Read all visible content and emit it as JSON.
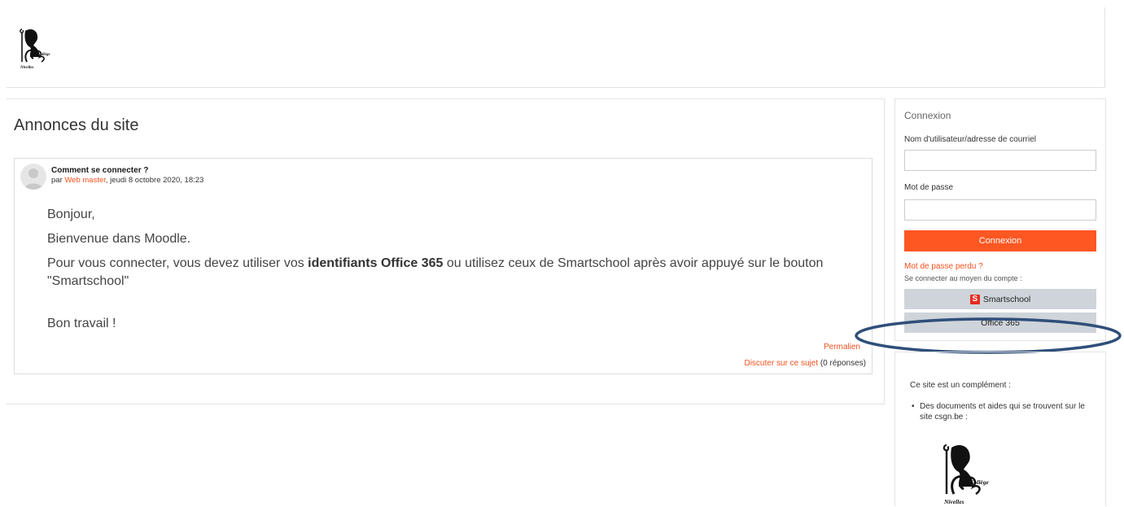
{
  "header": {
    "logo": {
      "icon": "college-logo-icon",
      "text_1": "Collège",
      "text_2": "Nivelles"
    }
  },
  "main": {
    "title": "Annonces du site",
    "post": {
      "subject": "Comment se connecter ?",
      "byline_prefix": "par ",
      "author": "Web master",
      "date": ", jeudi 8 octobre 2020, 18:23",
      "body": {
        "line1": "Bonjour,",
        "line2": "Bienvenue dans Moodle.",
        "line3_before": "Pour vous connecter, vous devez utiliser vos ",
        "line3_bold": "identifiants Office 365",
        "line3_after": " ou utilisez ceux de Smartschool après avoir appuyé sur le bouton \"Smartschool\"",
        "line4": "Bon travail !"
      },
      "permalink": "Permalien",
      "discuss": "Discuter sur ce sujet",
      "replies": " (0 réponses)"
    }
  },
  "login": {
    "title": "Connexion",
    "username_label": "Nom d'utilisateur/adresse de courriel",
    "username_value": "",
    "password_label": "Mot de passe",
    "password_value": "",
    "submit": "Connexion",
    "forgot": "Mot de passe perdu ?",
    "via": "Se connecter au moyen du compte :",
    "smartschool": "Smartschool",
    "smartschool_icon_letter": "S",
    "office365": "Office 365",
    "highlight_color": "#2f4f7a"
  },
  "info": {
    "intro": "Ce site est un complément :",
    "items": [
      "Des documents et aides qui se trouvent sur le site csgn.be :"
    ],
    "logo": {
      "icon": "college-logo-icon",
      "text_1": "Collège",
      "text_2": "Nivelles"
    }
  },
  "colors": {
    "accent": "#ff5722",
    "link": "#f4511e",
    "sso_button": "#ced4da"
  }
}
